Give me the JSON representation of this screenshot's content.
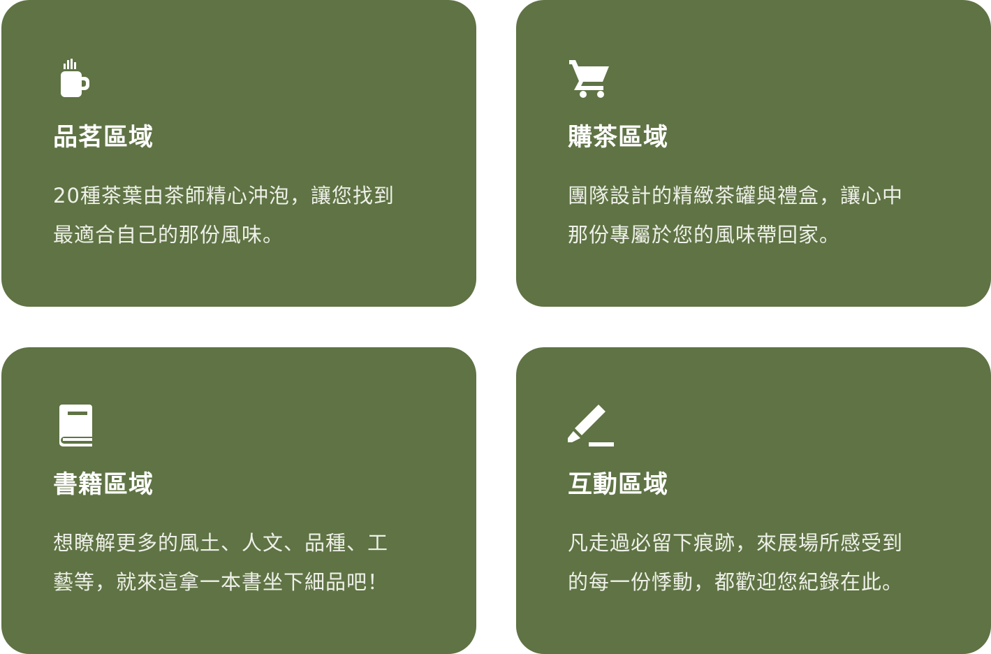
{
  "theme": {
    "card_bg": "#5f7344",
    "text": "#ffffff"
  },
  "cards": [
    {
      "icon": "tea-mug-icon",
      "title": "品茗區域",
      "desc": [
        "20種茶葉由茶師精心沖泡，讓您找到",
        "最適合自己的那份風味。"
      ]
    },
    {
      "icon": "shopping-cart-icon",
      "title": "購茶區域",
      "desc": [
        "團隊設計的精緻茶罐與禮盒，讓心中",
        "那份專屬於您的風味帶回家。"
      ]
    },
    {
      "icon": "book-icon",
      "title": "書籍區域",
      "desc": [
        "想瞭解更多的風土、人文、品種、工",
        "藝等，就來這拿一本書坐下細品吧！"
      ]
    },
    {
      "icon": "pencil-icon",
      "title": "互動區域",
      "desc": [
        "凡走過必留下痕跡，來展場所感受到",
        "的每一份悸動，都歡迎您紀錄在此。"
      ]
    }
  ]
}
